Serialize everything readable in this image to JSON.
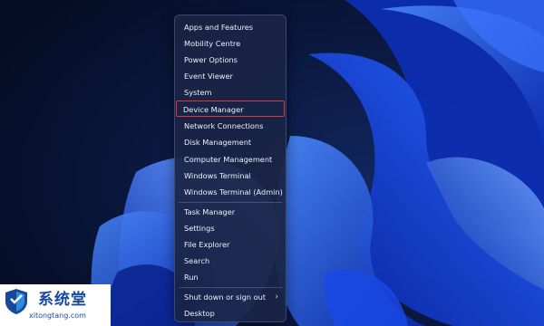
{
  "power_menu": {
    "items": [
      {
        "label": "Apps and Features"
      },
      {
        "label": "Mobility Centre"
      },
      {
        "label": "Power Options"
      },
      {
        "label": "Event Viewer"
      },
      {
        "label": "System"
      },
      {
        "label": "Device Manager",
        "highlighted": true
      },
      {
        "label": "Network Connections"
      },
      {
        "label": "Disk Management"
      },
      {
        "label": "Computer Management"
      },
      {
        "label": "Windows Terminal"
      },
      {
        "label": "Windows Terminal (Admin)"
      },
      {
        "label": "Task Manager"
      },
      {
        "label": "Settings"
      },
      {
        "label": "File Explorer"
      },
      {
        "label": "Search"
      },
      {
        "label": "Run"
      },
      {
        "label": "Shut down or sign out",
        "submenu": true
      },
      {
        "label": "Desktop"
      }
    ],
    "submenu_icon": "chevron-right-icon",
    "highlight_color": "#e0363b"
  },
  "watermark": {
    "title": "系统堂",
    "url": "xitongtang.com",
    "icon": "shield-icon",
    "color": "#17489a"
  },
  "wallpaper": {
    "name": "windows-11-bloom",
    "background_color": "#08132e",
    "accent_color": "#1f4fe0"
  }
}
